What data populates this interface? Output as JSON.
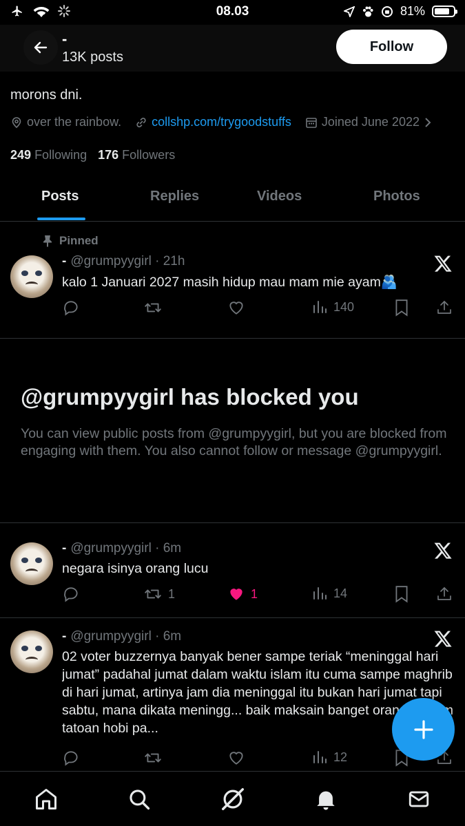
{
  "status_bar": {
    "time": "08.03",
    "battery": "81%",
    "battery_level": 0.81
  },
  "profile": {
    "name": "-",
    "post_count": "13K posts",
    "follow_label": "Follow",
    "bio": "morons dni.",
    "location": "over the rainbow.",
    "link": "collshp.com/trygoodstuffs",
    "joined": "Joined June 2022",
    "following_count": "249",
    "following_label": "Following",
    "followers_count": "176",
    "followers_label": "Followers"
  },
  "tabs": [
    "Posts",
    "Replies",
    "Videos",
    "Photos"
  ],
  "pinned_post": {
    "pinned_label": "Pinned",
    "name": "-",
    "handle_time": "@grumpyygirl · 21h",
    "text": "kalo 1 Januari 2027 masih hidup mau mam mie ayam🫂",
    "views": "140"
  },
  "blocked_notice": {
    "title": "@grumpyygirl has blocked you",
    "description": "You can view public posts from @grumpyygirl, but you are blocked from engaging with them. You also cannot follow or message @grumpyygirl."
  },
  "posts": [
    {
      "name": "-",
      "handle_time": "@grumpyygirl · 6m",
      "text": "negara isinya orang lucu",
      "reposts": "1",
      "likes": "1",
      "views": "14"
    },
    {
      "name": "-",
      "handle_time": "@grumpyygirl · 6m",
      "text": "02 voter buzzernya banyak bener sampe teriak “meninggal hari jumat” padahal jumat dalam waktu islam itu cuma sampe maghrib di hari jumat, artinya jam dia meninggal itu bukan hari jumat tapi sabtu, mana dikata meningg... baik maksain banget orang muslim tatoan hobi pa...",
      "views": "12"
    }
  ],
  "colors": {
    "accent": "#1d9bf0",
    "like": "#f91880",
    "muted": "#71767b",
    "background": "#000000"
  },
  "icons": {
    "nav": [
      "home-icon",
      "search-icon",
      "grok-icon",
      "notifications-icon",
      "messages-icon"
    ]
  }
}
